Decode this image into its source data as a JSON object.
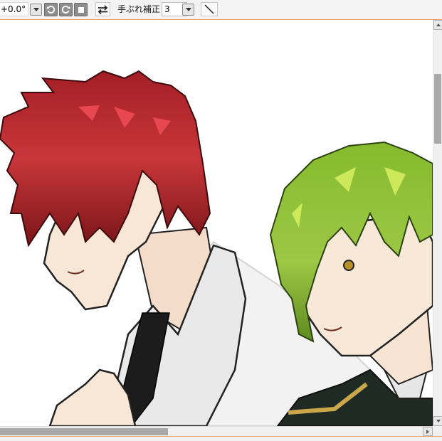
{
  "toolbar": {
    "rotation_value": "+0.0°",
    "stabilizer_label": "手ぶれ補正",
    "stabilizer_value": "3",
    "icons": [
      "rotate-left-icon",
      "rotate-right-icon",
      "reset-square-icon",
      "flip-horizontal-icon",
      "straight-line-icon"
    ]
  },
  "colors": {
    "accent_border": "#e0a070",
    "red_hair": "#b22a2e",
    "green_hair": "#8fbf35",
    "skin": "#f8e6d6",
    "shirt": "#ececec",
    "tie": "#1c1c1c"
  },
  "scroll": {
    "vertical_position": 0.14,
    "horizontal_position": 0.0
  }
}
